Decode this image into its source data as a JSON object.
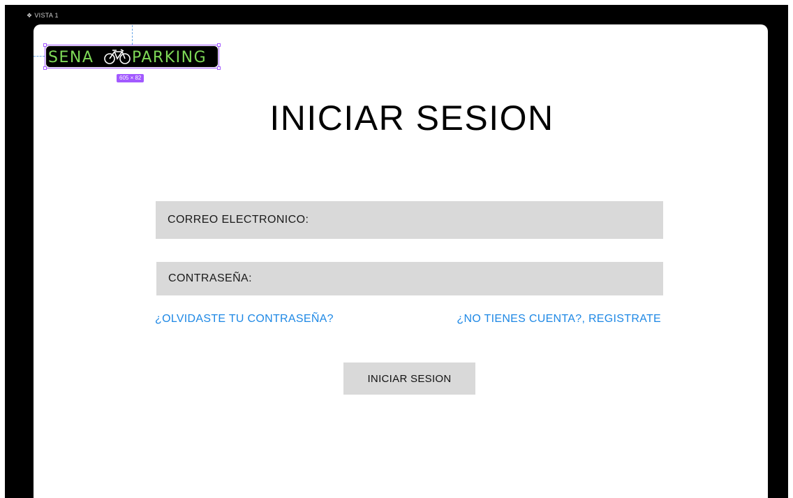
{
  "editor": {
    "frame_label": "VISTA 1",
    "frame_icon": "diamond-icon",
    "selection_size": "605 × 82",
    "selection_color": "#a259ff"
  },
  "logo": {
    "text_left": "SENA",
    "text_right": "PARKING",
    "icon": "bicycle-icon",
    "text_color": "#7ed957",
    "background": "#000000"
  },
  "page": {
    "title": "INICIAR SESION",
    "email_label": "CORREO ELECTRONICO:",
    "password_label": "CONTRASEÑA:",
    "forgot_link": "¿OLVIDASTE TU CONTRASEÑA?",
    "register_link": "¿NO TIENES CUENTA?, REGISTRATE",
    "submit_label": "INICIAR SESION"
  },
  "colors": {
    "link": "#1e88e5",
    "field_bg": "#d9d9d9"
  }
}
